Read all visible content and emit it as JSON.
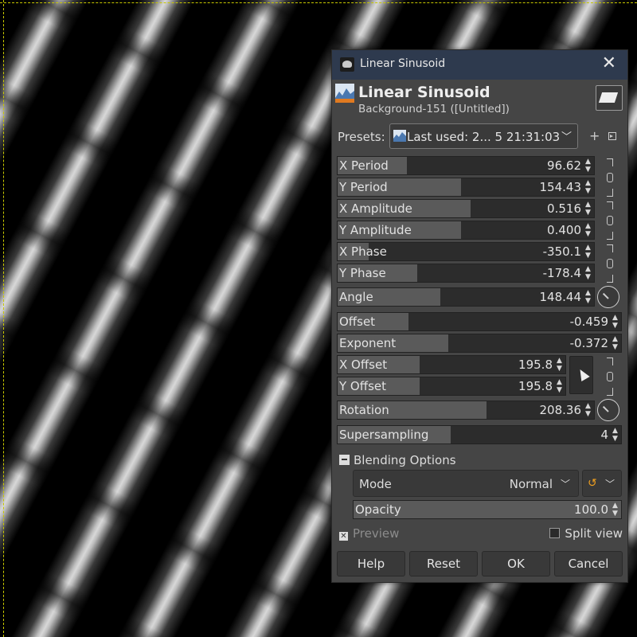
{
  "dialog": {
    "window_title": "Linear Sinusoid",
    "header_title": "Linear Sinusoid",
    "header_subtitle": "Background-151 ([Untitled])"
  },
  "presets": {
    "label": "Presets:",
    "value": "Last used: 2... 5 21:31:03"
  },
  "params": [
    {
      "label": "X Period",
      "value": "96.62",
      "fill": 0.27
    },
    {
      "label": "Y Period",
      "value": "154.43",
      "fill": 0.48
    },
    {
      "label": "X Amplitude",
      "value": "0.516",
      "fill": 0.52
    },
    {
      "label": "Y Amplitude",
      "value": "0.400",
      "fill": 0.48
    },
    {
      "label": "X Phase",
      "value": "-350.1",
      "fill": 0.12
    },
    {
      "label": "Y Phase",
      "value": "-178.4",
      "fill": 0.31
    },
    {
      "label": "Angle",
      "value": "148.44",
      "fill": 0.4
    },
    {
      "label": "Offset",
      "value": "-0.459",
      "fill": 0.25
    },
    {
      "label": "Exponent",
      "value": "-0.372",
      "fill": 0.39
    },
    {
      "label": "X Offset",
      "value": "195.8",
      "fill": 0.36
    },
    {
      "label": "Y Offset",
      "value": "195.8",
      "fill": 0.36
    },
    {
      "label": "Rotation",
      "value": "208.36",
      "fill": 0.58
    },
    {
      "label": "Supersampling",
      "value": "4",
      "fill": 0.4
    }
  ],
  "blending": {
    "header": "Blending Options",
    "mode_label": "Mode",
    "mode_value": "Normal",
    "opacity_label": "Opacity",
    "opacity_value": "100.0",
    "opacity_fill": 1.0
  },
  "options": {
    "preview": "Preview",
    "split_view": "Split view"
  },
  "buttons": {
    "help": "Help",
    "reset": "Reset",
    "ok": "OK",
    "cancel": "Cancel"
  }
}
